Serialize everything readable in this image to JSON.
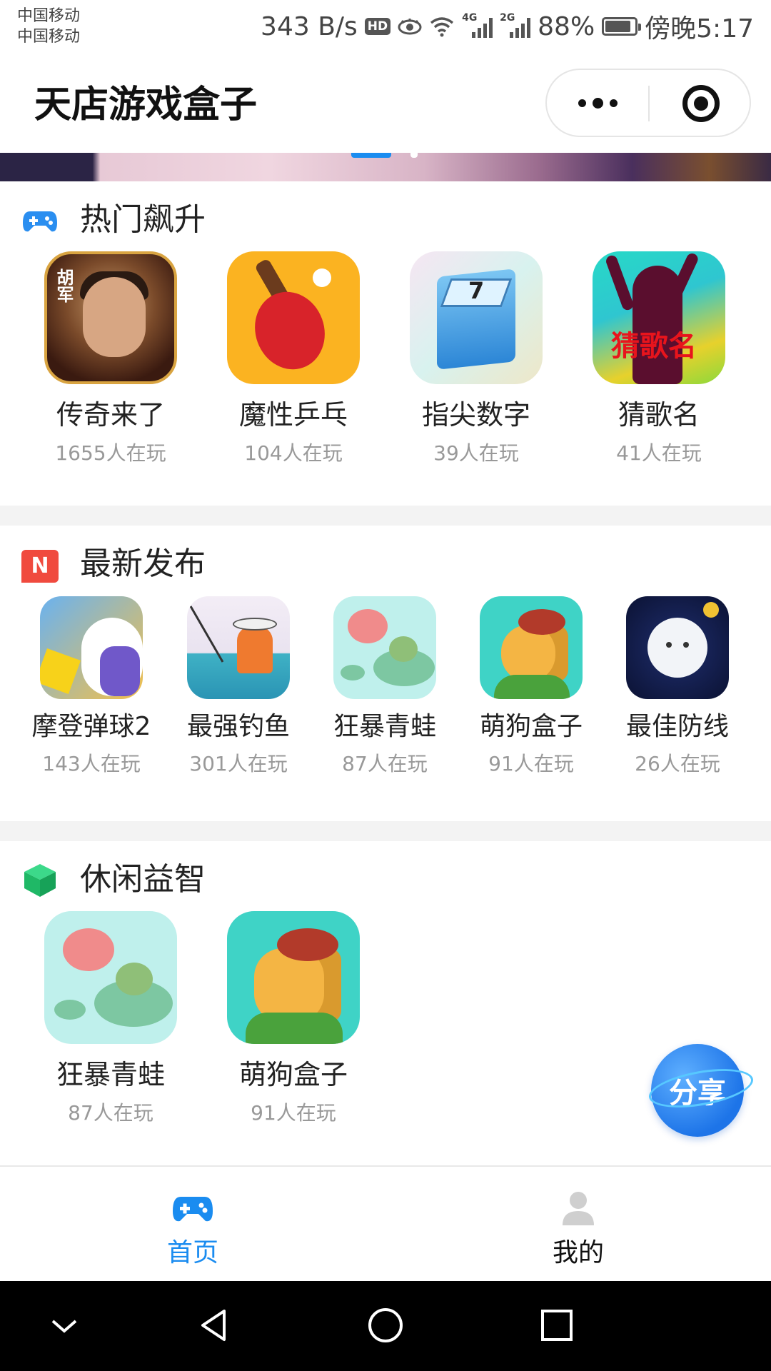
{
  "status_bar": {
    "carrier_1": "中国移动",
    "carrier_2": "中国移动",
    "speed": "343 B/s",
    "hd": "HD",
    "net_4g": "4G",
    "net_2g": "2G",
    "battery_pct": "88%",
    "time": "傍晚5:17"
  },
  "nav": {
    "title": "天店游戏盒子"
  },
  "banner": {
    "active_index": 0,
    "count": 2
  },
  "sections": {
    "hot": {
      "title": "热门飙升",
      "games": [
        {
          "name": "传奇来了",
          "players": "1655人在玩",
          "icon_text": "胡军"
        },
        {
          "name": "魔性乒乓",
          "players": "104人在玩"
        },
        {
          "name": "指尖数字",
          "players": "39人在玩",
          "icon_text": "7"
        },
        {
          "name": "猜歌名",
          "players": "41人在玩",
          "icon_text": "猜歌名"
        }
      ]
    },
    "new": {
      "title": "最新发布",
      "badge": "N",
      "games": [
        {
          "name": "摩登弹球2",
          "players": "143人在玩"
        },
        {
          "name": "最强钓鱼",
          "players": "301人在玩"
        },
        {
          "name": "狂暴青蛙",
          "players": "87人在玩"
        },
        {
          "name": "萌狗盒子",
          "players": "91人在玩"
        },
        {
          "name": "最佳防线",
          "players": "26人在玩"
        }
      ]
    },
    "casual": {
      "title": "休闲益智",
      "games": [
        {
          "name": "狂暴青蛙",
          "players": "87人在玩"
        },
        {
          "name": "萌狗盒子",
          "players": "91人在玩"
        }
      ]
    }
  },
  "share": {
    "label": "分享"
  },
  "tab_bar": {
    "home": "首页",
    "mine": "我的",
    "active_color": "#1a8cf0"
  },
  "colors": {
    "accent": "#1a8cf0",
    "count_gray": "#999999"
  }
}
